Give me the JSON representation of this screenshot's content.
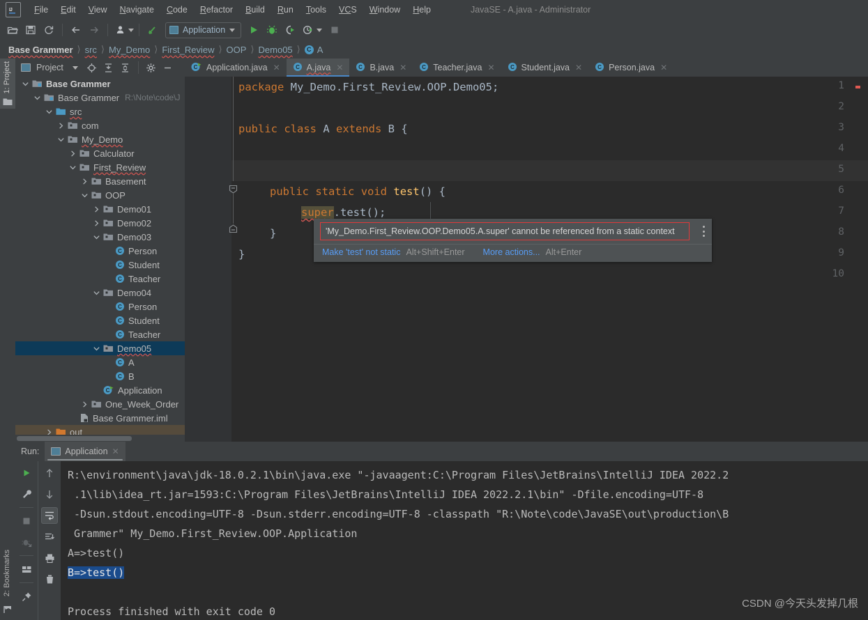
{
  "window": {
    "title": "JavaSE - A.java - Administrator",
    "logo": "intellij-idea-logo"
  },
  "menubar": {
    "items": [
      {
        "label": "File",
        "mnemonic": "F"
      },
      {
        "label": "Edit",
        "mnemonic": "E"
      },
      {
        "label": "View",
        "mnemonic": "V"
      },
      {
        "label": "Navigate",
        "mnemonic": "N"
      },
      {
        "label": "Code",
        "mnemonic": "C"
      },
      {
        "label": "Refactor",
        "mnemonic": "R"
      },
      {
        "label": "Build",
        "mnemonic": "B"
      },
      {
        "label": "Run",
        "mnemonic": "R"
      },
      {
        "label": "Tools",
        "mnemonic": "T"
      },
      {
        "label": "VCS",
        "mnemonic": "V"
      },
      {
        "label": "Window",
        "mnemonic": "W"
      },
      {
        "label": "Help",
        "mnemonic": "H"
      }
    ]
  },
  "toolbar": {
    "open_label": "open-folder-icon",
    "save_label": "save-icon",
    "sync_label": "sync-icon",
    "back_label": "back-arrow-icon",
    "forward_label": "forward-arrow-icon",
    "profile_label": "user-profile-icon",
    "update_label": "update-project-icon",
    "run_config_name": "Application",
    "run_label": "run-icon",
    "debug_label": "debug-icon",
    "run_coverage_label": "run-with-coverage-icon",
    "profiler_label": "profiler-icon",
    "stop_label": "stop-icon"
  },
  "breadcrumb": {
    "items": [
      {
        "label": "Base Grammer",
        "strong": true,
        "wavy": false,
        "icon": ""
      },
      {
        "label": "src",
        "strong": false,
        "wavy": true,
        "icon": ""
      },
      {
        "label": "My_Demo",
        "strong": false,
        "wavy": true,
        "icon": ""
      },
      {
        "label": "First_Review",
        "strong": false,
        "wavy": true,
        "icon": ""
      },
      {
        "label": "OOP",
        "strong": false,
        "wavy": false,
        "icon": ""
      },
      {
        "label": "Demo05",
        "strong": false,
        "wavy": true,
        "icon": ""
      },
      {
        "label": "A",
        "strong": false,
        "wavy": false,
        "icon": "class-icon"
      }
    ],
    "separator": "❯"
  },
  "left_stripe": {
    "project_label": "1: Project",
    "bookmarks_label": "2: Bookmarks"
  },
  "project_panel": {
    "title": "Project",
    "buttons": [
      {
        "name": "dropdown-caret-icon"
      },
      {
        "name": "locate-target-icon"
      },
      {
        "name": "expand-all-icon"
      },
      {
        "name": "collapse-all-icon"
      },
      {
        "name": "settings-gear-icon"
      },
      {
        "name": "hide-panel-icon"
      }
    ],
    "tree": [
      {
        "label": "Base Grammer",
        "indent": 0,
        "arrow": "down",
        "icon": "module-icon",
        "bold": true,
        "wavy": false,
        "path": "",
        "state": "normal"
      },
      {
        "label": "Base Grammer",
        "indent": 1,
        "arrow": "down",
        "icon": "module-icon",
        "bold": false,
        "wavy": false,
        "path": "R:\\Note\\code\\J",
        "state": "normal"
      },
      {
        "label": "src",
        "indent": 2,
        "arrow": "down",
        "icon": "source-root-icon",
        "bold": false,
        "wavy": true,
        "path": "",
        "state": "normal"
      },
      {
        "label": "com",
        "indent": 3,
        "arrow": "right",
        "icon": "package-icon",
        "bold": false,
        "wavy": false,
        "path": "",
        "state": "normal"
      },
      {
        "label": "My_Demo",
        "indent": 3,
        "arrow": "down",
        "icon": "package-icon",
        "bold": false,
        "wavy": true,
        "path": "",
        "state": "normal"
      },
      {
        "label": "Calculator",
        "indent": 4,
        "arrow": "right",
        "icon": "package-icon",
        "bold": false,
        "wavy": false,
        "path": "",
        "state": "normal"
      },
      {
        "label": "First_Review",
        "indent": 4,
        "arrow": "down",
        "icon": "package-icon",
        "bold": false,
        "wavy": true,
        "path": "",
        "state": "normal"
      },
      {
        "label": "Basement",
        "indent": 5,
        "arrow": "right",
        "icon": "package-icon",
        "bold": false,
        "wavy": false,
        "path": "",
        "state": "normal"
      },
      {
        "label": "OOP",
        "indent": 5,
        "arrow": "down",
        "icon": "package-icon",
        "bold": false,
        "wavy": false,
        "path": "",
        "state": "normal"
      },
      {
        "label": "Demo01",
        "indent": 6,
        "arrow": "right",
        "icon": "package-icon",
        "bold": false,
        "wavy": false,
        "path": "",
        "state": "normal"
      },
      {
        "label": "Demo02",
        "indent": 6,
        "arrow": "right",
        "icon": "package-icon",
        "bold": false,
        "wavy": false,
        "path": "",
        "state": "normal"
      },
      {
        "label": "Demo03",
        "indent": 6,
        "arrow": "down",
        "icon": "package-icon",
        "bold": false,
        "wavy": false,
        "path": "",
        "state": "normal"
      },
      {
        "label": "Person",
        "indent": 7,
        "arrow": "none",
        "icon": "class-icon",
        "bold": false,
        "wavy": false,
        "path": "",
        "state": "normal"
      },
      {
        "label": "Student",
        "indent": 7,
        "arrow": "none",
        "icon": "class-icon",
        "bold": false,
        "wavy": false,
        "path": "",
        "state": "normal"
      },
      {
        "label": "Teacher",
        "indent": 7,
        "arrow": "none",
        "icon": "class-icon",
        "bold": false,
        "wavy": false,
        "path": "",
        "state": "normal"
      },
      {
        "label": "Demo04",
        "indent": 6,
        "arrow": "down",
        "icon": "package-icon",
        "bold": false,
        "wavy": false,
        "path": "",
        "state": "normal"
      },
      {
        "label": "Person",
        "indent": 7,
        "arrow": "none",
        "icon": "class-icon",
        "bold": false,
        "wavy": false,
        "path": "",
        "state": "normal"
      },
      {
        "label": "Student",
        "indent": 7,
        "arrow": "none",
        "icon": "class-icon",
        "bold": false,
        "wavy": false,
        "path": "",
        "state": "normal"
      },
      {
        "label": "Teacher",
        "indent": 7,
        "arrow": "none",
        "icon": "class-icon",
        "bold": false,
        "wavy": false,
        "path": "",
        "state": "normal"
      },
      {
        "label": "Demo05",
        "indent": 6,
        "arrow": "down",
        "icon": "package-icon",
        "bold": false,
        "wavy": true,
        "path": "",
        "state": "selected"
      },
      {
        "label": "A",
        "indent": 7,
        "arrow": "none",
        "icon": "class-icon",
        "bold": false,
        "wavy": false,
        "path": "",
        "state": "normal"
      },
      {
        "label": "B",
        "indent": 7,
        "arrow": "none",
        "icon": "class-icon",
        "bold": false,
        "wavy": false,
        "path": "",
        "state": "normal"
      },
      {
        "label": "Application",
        "indent": 6,
        "arrow": "none",
        "icon": "runnable-class-icon",
        "bold": false,
        "wavy": false,
        "path": "",
        "state": "normal"
      },
      {
        "label": "One_Week_Order",
        "indent": 5,
        "arrow": "right",
        "icon": "package-icon",
        "bold": false,
        "wavy": false,
        "path": "",
        "state": "normal"
      },
      {
        "label": "Base Grammer.iml",
        "indent": 4,
        "arrow": "none",
        "icon": "iml-file-icon",
        "bold": false,
        "wavy": false,
        "path": "",
        "state": "normal"
      },
      {
        "label": "out",
        "indent": 2,
        "arrow": "right",
        "icon": "out-folder-icon",
        "bold": false,
        "wavy": false,
        "path": "",
        "state": "excluded"
      }
    ]
  },
  "editor": {
    "tabs": [
      {
        "label": "Application.java",
        "icon": "runnable-class-icon",
        "active": false,
        "wavy": false
      },
      {
        "label": "A.java",
        "icon": "class-icon",
        "active": true,
        "wavy": true
      },
      {
        "label": "B.java",
        "icon": "class-icon",
        "active": false,
        "wavy": false
      },
      {
        "label": "Teacher.java",
        "icon": "class-icon",
        "active": false,
        "wavy": false
      },
      {
        "label": "Student.java",
        "icon": "class-icon",
        "active": false,
        "wavy": false
      },
      {
        "label": "Person.java",
        "icon": "class-icon",
        "active": false,
        "wavy": false
      }
    ],
    "line_numbers": [
      "1",
      "2",
      "3",
      "4",
      "5",
      "6",
      "7",
      "8",
      "9",
      "10"
    ],
    "code": {
      "l1_kw": "package",
      "l1_rest": " My_Demo.First_Review.OOP.Demo05;",
      "l3_kw1": "public",
      "l3_kw2": "class",
      "l3_name": " A ",
      "l3_kw3": "extends",
      "l3_tail": " B {",
      "l6_kw1": "public",
      "l6_kw2": "static",
      "l6_kw3": "void",
      "l6_fn": "test",
      "l6_tail": "() {",
      "l7_super": "super",
      "l7_dot": ".",
      "l7_fn": "test",
      "l7_tail": "();",
      "l8": "}",
      "l9": "}"
    }
  },
  "error_popup": {
    "message": "'My_Demo.First_Review.OOP.Demo05.A.super' cannot be referenced from a static context",
    "action1_label": "Make 'test' not static",
    "action1_key": "Alt+Shift+Enter",
    "action2_label": "More actions...",
    "action2_key": "Alt+Enter",
    "menu_icon": "more-options-icon",
    "border_color": "#e03a3a"
  },
  "run_panel": {
    "title": "Run:",
    "tab_label": "Application",
    "tab_icon": "run-config-icon",
    "left_tools": [
      {
        "name": "rerun-icon"
      },
      {
        "name": "wrench-settings-icon"
      },
      {
        "name": "stop-icon"
      },
      {
        "name": "close-process-icon"
      },
      {
        "name": "layout-icon"
      },
      {
        "name": "pin-tab-icon"
      }
    ],
    "right_tools": [
      {
        "name": "up-arrow-icon"
      },
      {
        "name": "down-arrow-icon"
      },
      {
        "name": "soft-wrap-icon"
      },
      {
        "name": "scroll-to-end-icon"
      },
      {
        "name": "print-icon"
      },
      {
        "name": "trash-icon"
      }
    ],
    "console_lines": [
      {
        "text": "R:\\environment\\java\\jdk-18.0.2.1\\bin\\java.exe \"-javaagent:C:\\Program Files\\JetBrains\\IntelliJ IDEA 2022.2",
        "highlight": false
      },
      {
        "text": " .1\\lib\\idea_rt.jar=1593:C:\\Program Files\\JetBrains\\IntelliJ IDEA 2022.2.1\\bin\" -Dfile.encoding=UTF-8",
        "highlight": false
      },
      {
        "text": " -Dsun.stdout.encoding=UTF-8 -Dsun.stderr.encoding=UTF-8 -classpath \"R:\\Note\\code\\JavaSE\\out\\production\\B",
        "highlight": false
      },
      {
        "text": " Grammer\" My_Demo.First_Review.OOP.Application",
        "highlight": false
      },
      {
        "text": "A=>test()",
        "highlight": false
      },
      {
        "text": "B=>test()",
        "highlight": true
      },
      {
        "text": "",
        "highlight": false
      },
      {
        "text": "Process finished with exit code 0",
        "highlight": false
      }
    ]
  },
  "watermark": {
    "text": "CSDN @今天头发掉几根"
  },
  "colors": {
    "panel_bg": "#3c3f41",
    "editor_bg": "#2b2b2b",
    "gutter_bg": "#313335",
    "accent_blue": "#4a88c7",
    "error_red": "#e03a3a",
    "selection_blue": "#0d3a58",
    "keyword_orange": "#cc7832",
    "method_yellow": "#ffc66d",
    "text_grey": "#a9b7c6",
    "link_blue": "#589df6"
  }
}
